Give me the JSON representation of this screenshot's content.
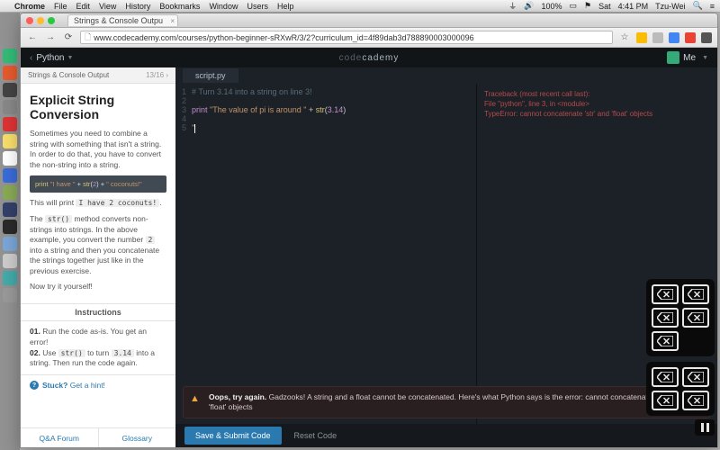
{
  "mac_menu": {
    "app": "Chrome",
    "items": [
      "File",
      "Edit",
      "View",
      "History",
      "Bookmarks",
      "Window",
      "Users",
      "Help"
    ],
    "right": {
      "battery": "100%",
      "day": "Sat",
      "time": "4:41 PM",
      "user": "Tzu-Wei"
    }
  },
  "browser": {
    "tab_title": "Strings & Console Outpu",
    "url": "www.codecademy.com/courses/python-beginner-sRXwR/3/2?curriculum_id=4f89dab3d788890003000096"
  },
  "header": {
    "course": "Python",
    "logo_a": "code",
    "logo_b": "cademy",
    "user": "Me"
  },
  "lesson": {
    "crumb": "Strings & Console Output",
    "counter": "13/16 ›",
    "title": "Explicit String Conversion",
    "p1": "Sometimes you need to combine a string with something that isn't a string. In order to do that, you have to convert the non-string into a string.",
    "code_print": "print ",
    "code_s1": "\"I have \"",
    "code_plus": " + ",
    "code_fn": "str",
    "code_paren_open": "(",
    "code_num": "2",
    "code_paren_close": ")",
    "code_s2": "\" coconuts!\"",
    "p2a": "This will print ",
    "p2code": "I have 2 coconuts!",
    "p2b": ".",
    "p3a": "The ",
    "p3code": "str()",
    "p3b": " method converts non-strings into strings. In the above example, you convert the number ",
    "p3code2": "2",
    "p3c": " into a string and then you concatenate the strings together just like in the previous exercise.",
    "p4": "Now try it yourself!",
    "instructions_tab": "Instructions",
    "step1_n": "01.",
    "step1": " Run the code as-is. You get an error!",
    "step2_n": "02.",
    "step2a": " Use ",
    "step2code": "str()",
    "step2b": " to turn ",
    "step2code2": "3.14",
    "step2c": " into a string. Then run the code again.",
    "hint_label": "Stuck?",
    "hint_link": " Get a hint!",
    "footer_qa": "Q&A Forum",
    "footer_gloss": "Glossary"
  },
  "editor": {
    "filename": "script.py",
    "l1": "# Turn 3.14 into a string on line 3!",
    "l3_print": "print ",
    "l3_str": "\"The value of pi is around \"",
    "l3_plus": " + ",
    "l3_fn": "str",
    "l3_open": "(",
    "l3_num": "3.14",
    "l3_close": ")",
    "l5": "\""
  },
  "console": {
    "l1": "Traceback (most recent call last):",
    "l2": "  File \"python\", line 3, in <module>",
    "l3": "TypeError: cannot concatenate 'str' and 'float' objects"
  },
  "error": {
    "title": "Oops, try again.",
    "body": " Gadzooks! A string and a float cannot be concatenated. Here's what Python says is the error: cannot concatenate 'str' and 'float' objects"
  },
  "actions": {
    "submit": "Save & Submit Code",
    "reset": "Reset Code"
  }
}
